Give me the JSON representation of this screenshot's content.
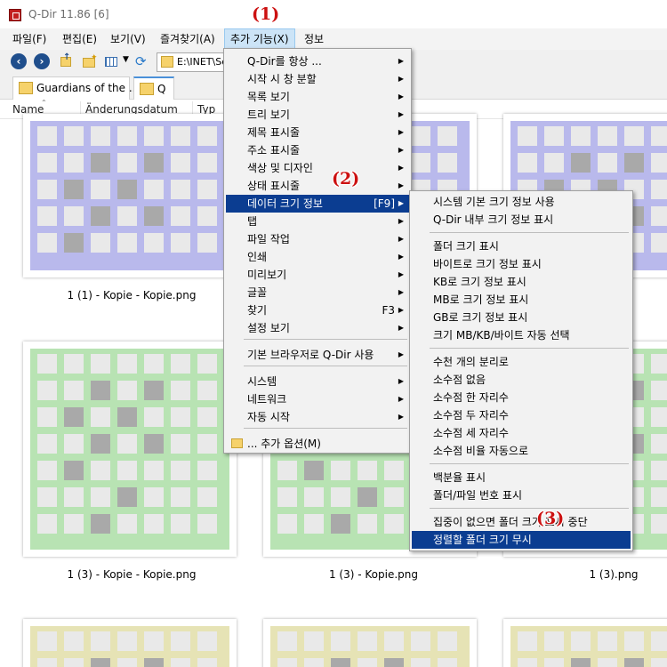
{
  "window": {
    "title": "Q-Dir 11.86 [6]"
  },
  "menubar": {
    "items": [
      "파일(F)",
      "편집(E)",
      "보기(V)",
      "즐겨찾기(A)",
      "추가 기능(X)",
      "정보"
    ]
  },
  "toolbar": {
    "back_icon": "back-arrow-icon",
    "forward_icon": "forward-arrow-icon",
    "address": "E:\\INET\\Sc"
  },
  "tabs": [
    "Guardians of the ...",
    "Q"
  ],
  "columns": [
    "Name",
    "Änderungsdatum",
    "Typ"
  ],
  "thumbnails": [
    {
      "caption": "1 (1) - Kopie - Kopie.png",
      "color": "#b9b9ec"
    },
    {
      "caption": "",
      "color": "#b9b9ec"
    },
    {
      "caption": "",
      "color": "#b9b9ec"
    },
    {
      "caption": "1 (3) - Kopie - Kopie.png",
      "color": "#b8e3b3"
    },
    {
      "caption": "1 (3) - Kopie.png",
      "color": "#b8e3b3"
    },
    {
      "caption": "1 (3).png",
      "color": "#b8e3b3"
    },
    {
      "caption": "",
      "color": "#e6e3b5"
    },
    {
      "caption": "",
      "color": "#e6e3b5"
    },
    {
      "caption": "",
      "color": "#e6e3b5"
    }
  ],
  "menu1": {
    "items": [
      {
        "label": "Q-Dir를 항상 ...",
        "submenu": true
      },
      {
        "label": "시작 시 창 분할",
        "submenu": true
      },
      {
        "label": "목록 보기",
        "submenu": true
      },
      {
        "label": "트리 보기",
        "submenu": true
      },
      {
        "label": "제목 표시줄",
        "submenu": true
      },
      {
        "label": "주소 표시줄",
        "submenu": true
      },
      {
        "label": "색상 및 디자인",
        "submenu": true
      },
      {
        "label": "상태 표시줄",
        "submenu": true
      },
      {
        "label": "데이터 크기 정보",
        "shortcut": "[F9]",
        "submenu": true
      },
      {
        "label": "탭",
        "submenu": true
      },
      {
        "label": "파일 작업",
        "submenu": true
      },
      {
        "label": "인쇄",
        "submenu": true
      },
      {
        "label": "미리보기",
        "submenu": true
      },
      {
        "label": "글꼴",
        "submenu": true
      },
      {
        "label": "찾기",
        "shortcut": "F3",
        "submenu": true
      },
      {
        "label": "설정 보기",
        "submenu": true
      },
      {
        "label": "기본 브라우저로 Q-Dir 사용",
        "submenu": true
      },
      {
        "label": "시스템",
        "submenu": true
      },
      {
        "label": "네트워크",
        "submenu": true
      },
      {
        "label": "자동 시작",
        "submenu": true
      },
      {
        "label": "... 추가 옵션(M)",
        "submenu": false
      }
    ]
  },
  "menu2": {
    "items": [
      "시스템 기본 크기 정보 사용",
      "Q-Dir 내부 크기 정보 표시",
      "폴더 크기 표시",
      "바이트로 크기 정보 표시",
      "KB로 크기 정보 표시",
      "MB로 크기 정보 표시",
      "GB로 크기 정보 표시",
      "크기 MB/KB/바이트 자동 선택",
      "수천 개의 분리로",
      "소수점 없음",
      "소수점 한 자리수",
      "소수점 두 자리수",
      "소수점 세 자리수",
      "소수점 비율 자동으로",
      "백분율 표시",
      "폴더/파일 번호 표시",
      "집중이 없으면 폴더 크기 표시 중단",
      "정렬할 폴더 크기 무시"
    ]
  },
  "annotations": [
    "(1)",
    "(2)",
    "(3)"
  ],
  "colors": {
    "highlight": "#0b3d91",
    "annotation": "#cc1111"
  }
}
